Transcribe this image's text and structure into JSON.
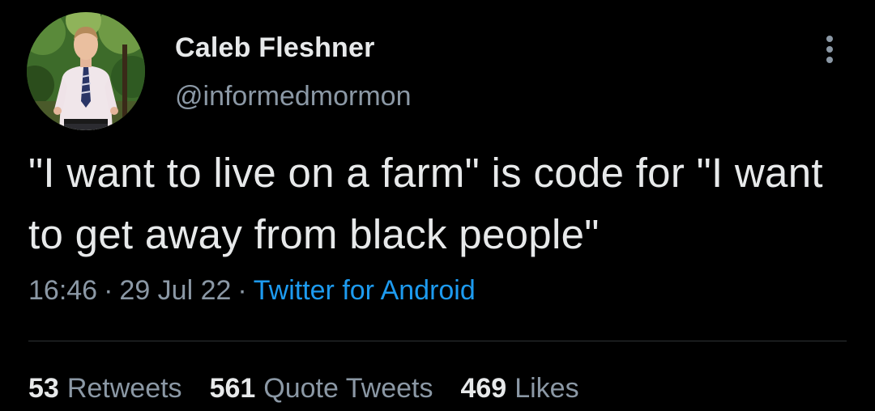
{
  "author": {
    "name": "Caleb Fleshner",
    "handle": "@informedmormon"
  },
  "tweet": {
    "text": "\"I want to live on a farm\" is code for \"I want to get away from black people\"",
    "time": "16:46",
    "date": "29 Jul 22",
    "separator": "·",
    "source": "Twitter for Android"
  },
  "stats": {
    "retweets_count": "53",
    "retweets_label": "Retweets",
    "quotes_count": "561",
    "quotes_label": "Quote Tweets",
    "likes_count": "469",
    "likes_label": "Likes"
  },
  "colors": {
    "background": "#000000",
    "primary_text": "#e7e9ea",
    "secondary_text": "#8b98a5",
    "accent": "#1d9bf0",
    "divider": "#2f3336"
  },
  "icons": {
    "more": "more-vertical-icon"
  }
}
